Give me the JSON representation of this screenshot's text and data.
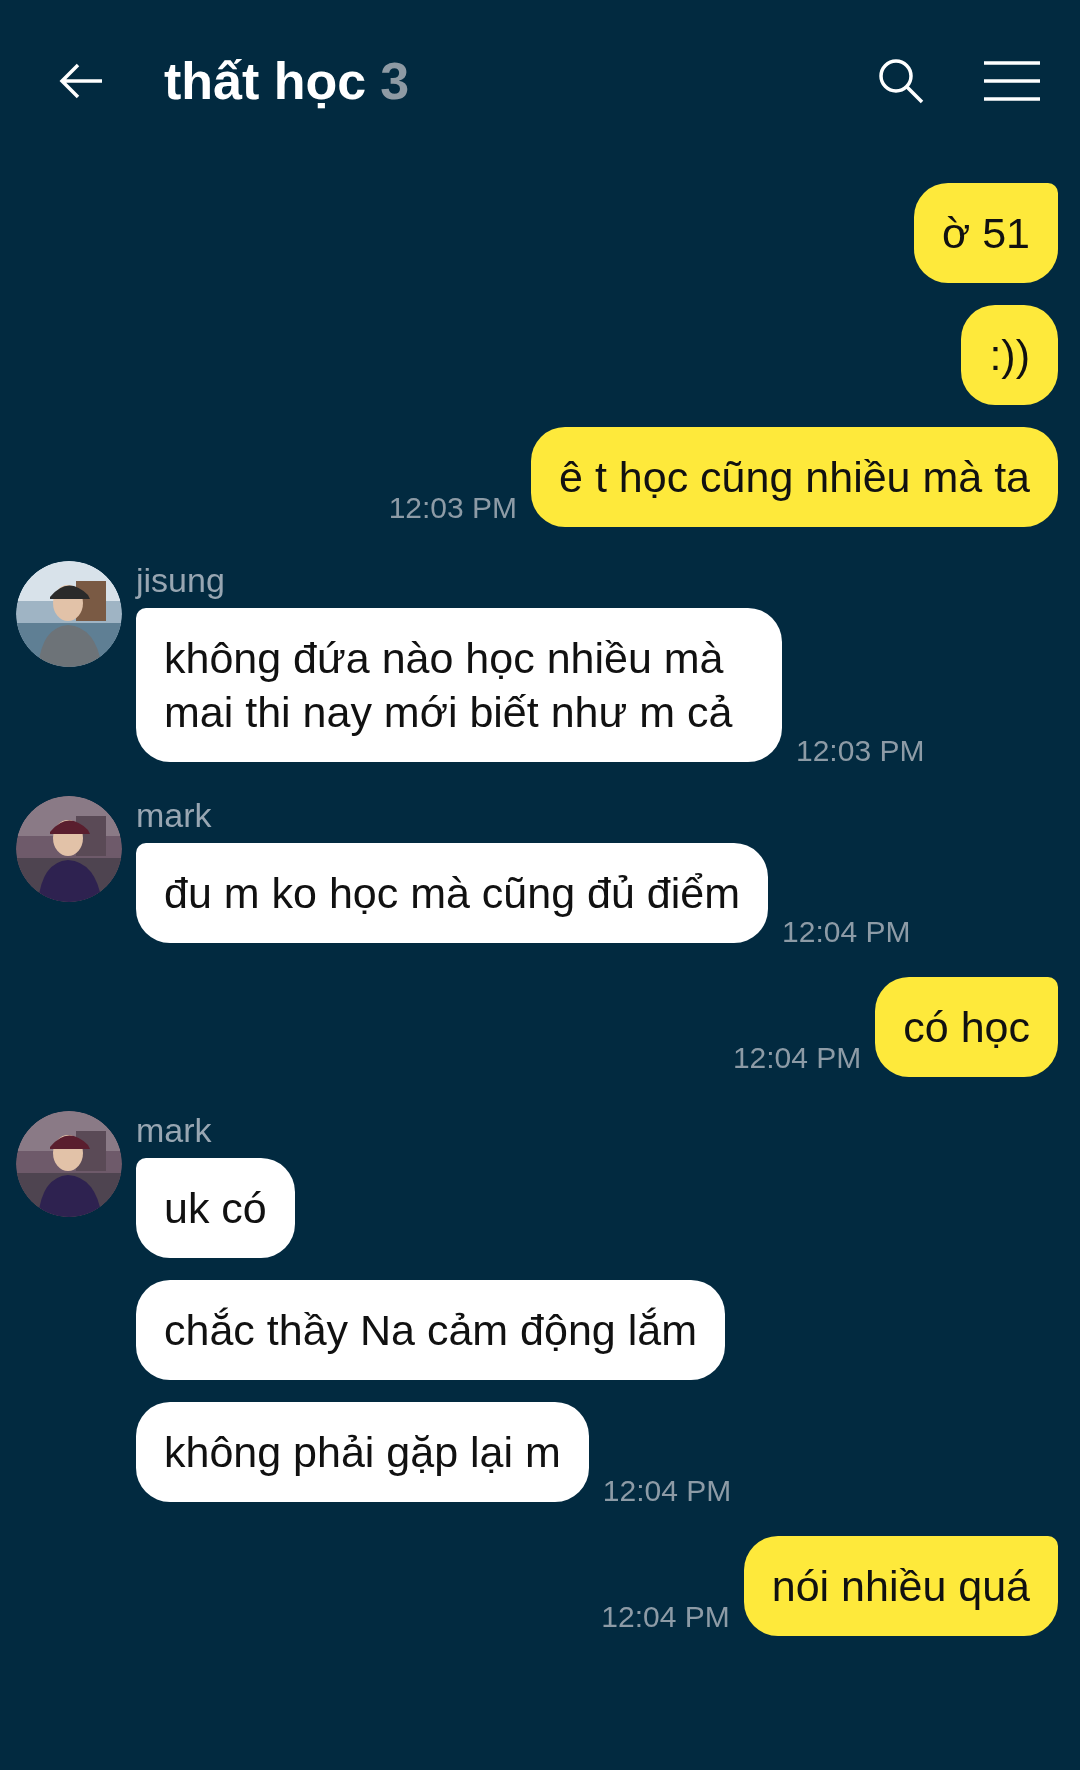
{
  "header": {
    "title": "thất học",
    "member_count": "3"
  },
  "groups": [
    {
      "kind": "outgoing",
      "messages": [
        "ờ 51",
        ":))",
        "ê t học cũng nhiều mà ta"
      ],
      "time": "12:03 PM"
    },
    {
      "kind": "incoming",
      "name": "jisung",
      "messages": [
        "không đứa nào học nhiều mà mai thi nay mới biết như m cả"
      ],
      "time": "12:03 PM"
    },
    {
      "kind": "incoming",
      "name": "mark",
      "messages": [
        "đu m ko học mà cũng đủ điểm"
      ],
      "time": "12:04 PM"
    },
    {
      "kind": "outgoing",
      "messages": [
        "có học"
      ],
      "time": "12:04 PM"
    },
    {
      "kind": "incoming",
      "name": "mark",
      "messages": [
        "uk có",
        "chắc thầy Na cảm động lắm",
        "không phải gặp lại m"
      ],
      "time": "12:04 PM"
    },
    {
      "kind": "outgoing",
      "messages": [
        "nói nhiều quá"
      ],
      "time": "12:04 PM"
    }
  ]
}
